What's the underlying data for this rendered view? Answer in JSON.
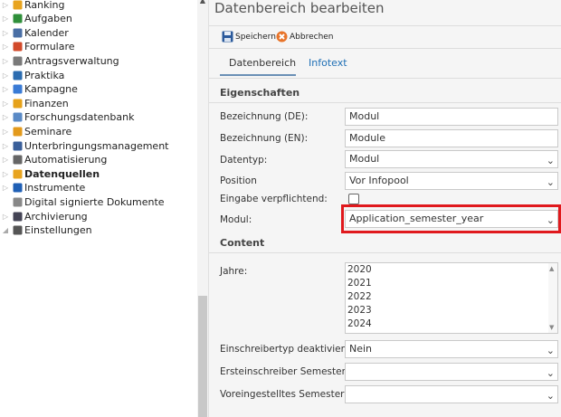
{
  "sidebar": {
    "items": [
      {
        "label": "Ranking",
        "icon": "ranking-icon",
        "bold": false
      },
      {
        "label": "Aufgaben",
        "icon": "tasks-icon",
        "bold": false
      },
      {
        "label": "Kalender",
        "icon": "calendar-icon",
        "bold": false
      },
      {
        "label": "Formulare",
        "icon": "forms-icon",
        "bold": false
      },
      {
        "label": "Antragsverwaltung",
        "icon": "applications-icon",
        "bold": false
      },
      {
        "label": "Praktika",
        "icon": "internships-icon",
        "bold": false
      },
      {
        "label": "Kampagne",
        "icon": "campaign-icon",
        "bold": false
      },
      {
        "label": "Finanzen",
        "icon": "finance-icon",
        "bold": false
      },
      {
        "label": "Forschungsdatenbank",
        "icon": "research-icon",
        "bold": false
      },
      {
        "label": "Seminare",
        "icon": "seminar-icon",
        "bold": false
      },
      {
        "label": "Unterbringungsmanagement",
        "icon": "housing-icon",
        "bold": false
      },
      {
        "label": "Automatisierung",
        "icon": "gear-icon",
        "bold": false
      },
      {
        "label": "Datenquellen",
        "icon": "datasource-icon",
        "bold": true
      },
      {
        "label": "Instrumente",
        "icon": "instruments-icon",
        "bold": false
      },
      {
        "label": "Digital signierte Dokumente",
        "icon": "document-icon",
        "bold": false
      },
      {
        "label": "Archivierung",
        "icon": "archive-icon",
        "bold": false
      },
      {
        "label": "Einstellungen",
        "icon": "settings-icon",
        "bold": false
      }
    ]
  },
  "page": {
    "title": "Datenbereich bearbeiten",
    "toolbar": {
      "save_label": "Speichern",
      "cancel_label": "Abbrechen"
    },
    "tabs": [
      {
        "label": "Datenbereich",
        "active": true
      },
      {
        "label": "Infotext",
        "active": false
      }
    ]
  },
  "eigenschaften": {
    "heading": "Eigenschaften",
    "bezeichnung_de": {
      "label": "Bezeichnung (DE):",
      "value": "Modul"
    },
    "bezeichnung_en": {
      "label": "Bezeichnung (EN):",
      "value": "Module"
    },
    "datentyp": {
      "label": "Datentyp:",
      "value": "Modul"
    },
    "position": {
      "label": "Position",
      "value": "Vor Infopool"
    },
    "eingabe": {
      "label": "Eingabe verpflichtend:",
      "checked": false
    },
    "modul": {
      "label": "Modul:",
      "value": "Application_semester_year"
    }
  },
  "content": {
    "heading": "Content",
    "jahre": {
      "label": "Jahre:",
      "options": [
        "2020",
        "2021",
        "2022",
        "2023",
        "2024"
      ]
    },
    "einschreibertyp": {
      "label": "Einschreibertyp deaktiviert:",
      "value": "Nein"
    },
    "ersteinschreiber": {
      "label": "Ersteinschreiber Semester:",
      "value": ""
    },
    "voreingestellt": {
      "label": "Voreingestelltes Semester:",
      "value": ""
    }
  },
  "colors": {
    "highlight": "#e0191d",
    "accent": "#1f6fb5"
  }
}
